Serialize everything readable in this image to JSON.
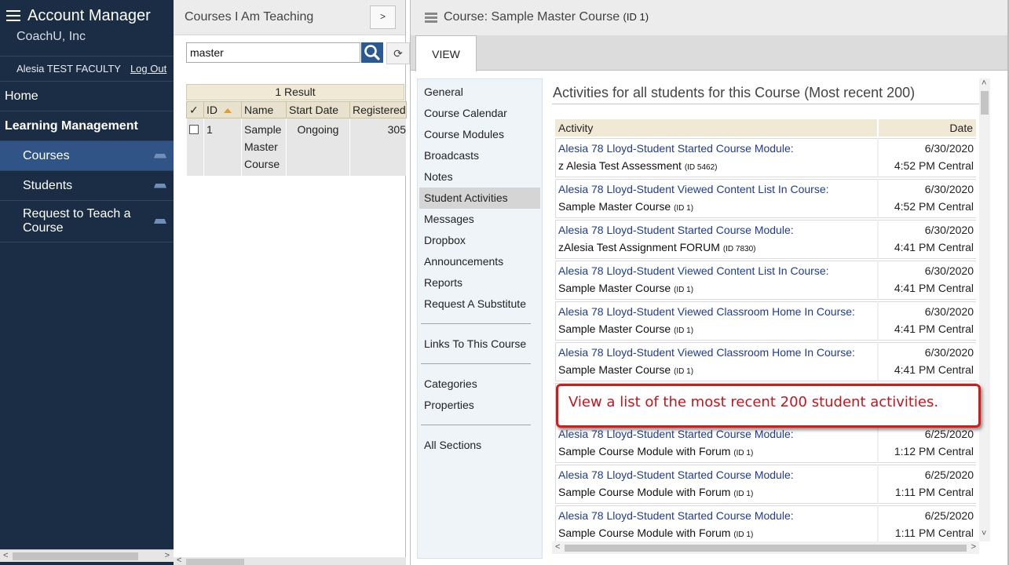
{
  "nav": {
    "app_title": "Account Manager",
    "org": "CoachU, Inc",
    "user": "Alesia TEST FACULTY",
    "logout": "Log Out",
    "home": "Home",
    "section": "Learning Management",
    "items": [
      {
        "label": "Courses",
        "active": true
      },
      {
        "label": "Students",
        "active": false
      },
      {
        "label": "Request to Teach a Course",
        "active": false
      }
    ]
  },
  "courses_panel": {
    "title": "Courses I Am Teaching",
    "collapse_label": ">",
    "search_value": "master",
    "refresh_label": "⟳",
    "results_label": "1 Result",
    "columns": [
      "✓",
      "ID",
      "Name",
      "Start Date",
      "Registered"
    ],
    "rows": [
      {
        "id": "1",
        "name": "Sample Master Course",
        "start_date": "Ongoing",
        "registered": "305"
      }
    ]
  },
  "detail": {
    "title": "Course: Sample Master Course",
    "title_id": "(ID 1)",
    "tab": "VIEW",
    "menu_groups": [
      [
        "General",
        "Course Calendar",
        "Course Modules",
        "Broadcasts",
        "Notes",
        "Student Activities",
        "Messages",
        "Dropbox",
        "Announcements",
        "Reports",
        "Request A Substitute"
      ],
      [
        "Links To This Course"
      ],
      [
        "Categories",
        "Properties"
      ],
      [
        "All Sections"
      ]
    ],
    "active_menu": "Student Activities",
    "content_title": "Activities for all students for this Course (Most recent 200)",
    "columns": {
      "activity": "Activity",
      "date": "Date"
    },
    "activities": [
      {
        "action": "Alesia 78 Lloyd-Student Started Course Module:",
        "object": "z Alesia Test Assessment",
        "object_id": "(ID 5462)",
        "date": "6/30/2020",
        "time": "4:52 PM Central"
      },
      {
        "action": "Alesia 78 Lloyd-Student Viewed Content List In Course:",
        "object": "Sample Master Course",
        "object_id": "(ID 1)",
        "date": "6/30/2020",
        "time": "4:52 PM Central"
      },
      {
        "action": "Alesia 78 Lloyd-Student Started Course Module:",
        "object": "zAlesia Test Assignment FORUM",
        "object_id": "(ID 7830)",
        "date": "6/30/2020",
        "time": "4:41 PM Central"
      },
      {
        "action": "Alesia 78 Lloyd-Student Viewed Content List In Course:",
        "object": "Sample Master Course",
        "object_id": "(ID 1)",
        "date": "6/30/2020",
        "time": "4:41 PM Central"
      },
      {
        "action": "Alesia 78 Lloyd-Student Viewed Classroom Home In Course:",
        "object": "Sample Master Course",
        "object_id": "(ID 1)",
        "date": "6/30/2020",
        "time": "4:41 PM Central"
      },
      {
        "action": "Alesia 78 Lloyd-Student Viewed Classroom Home In Course:",
        "object": "Sample Master Course",
        "object_id": "(ID 1)",
        "date": "6/30/2020",
        "time": "4:41 PM Central"
      },
      {
        "action": "",
        "object": "",
        "object_id": "",
        "date": "",
        "time": ""
      },
      {
        "action": "Alesia 78 Lloyd-Student Started Course Module:",
        "object": "Sample Course Module with Forum",
        "object_id": "(ID 1)",
        "date": "6/25/2020",
        "time": "1:12 PM Central"
      },
      {
        "action": "Alesia 78 Lloyd-Student Started Course Module:",
        "object": "Sample Course Module with Forum",
        "object_id": "(ID 1)",
        "date": "6/25/2020",
        "time": "1:11 PM Central"
      },
      {
        "action": "Alesia 78 Lloyd-Student Started Course Module:",
        "object": "Sample Course Module with Forum",
        "object_id": "(ID 1)",
        "date": "6/25/2020",
        "time": "1:11 PM Central"
      }
    ],
    "callout": "View a list of the most recent 200 student activities."
  },
  "colors": {
    "nav_bg": "#1b2d45",
    "nav_active": "#2f5485",
    "link": "#1f3c90",
    "callout": "#d61a1a"
  }
}
